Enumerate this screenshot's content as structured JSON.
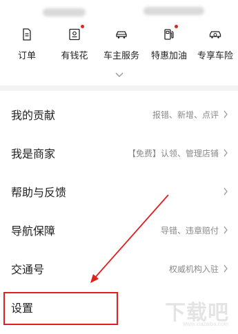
{
  "quick_actions": [
    {
      "label": "订单",
      "icon": "order-document-icon",
      "badge": false
    },
    {
      "label": "有钱花",
      "icon": "money-card-icon",
      "badge": true
    },
    {
      "label": "车主服务",
      "icon": "car-icon",
      "badge": false
    },
    {
      "label": "特惠加油",
      "icon": "fuel-pump-icon",
      "badge": true
    },
    {
      "label": "专享车险",
      "icon": "car-insurance-icon",
      "badge": false
    }
  ],
  "list": {
    "items": [
      {
        "title": "我的贡献",
        "subtitle": "报错、新增、点评"
      },
      {
        "title": "我是商家",
        "subtitle": "【免费】认领、管理店铺"
      },
      {
        "title": "帮助与反馈",
        "subtitle": ""
      },
      {
        "title": "导航保障",
        "subtitle": "导错、违章赔付"
      },
      {
        "title": "交通号",
        "subtitle": "权威机构入驻"
      },
      {
        "title": "设置",
        "subtitle": ""
      }
    ]
  },
  "watermark": {
    "text": "下载吧",
    "url": "www.xiazaiba.com"
  },
  "colors": {
    "accent_red": "#e01e1e",
    "badge_red": "#e1251b",
    "subtitle_gray": "#8a8a8a"
  }
}
